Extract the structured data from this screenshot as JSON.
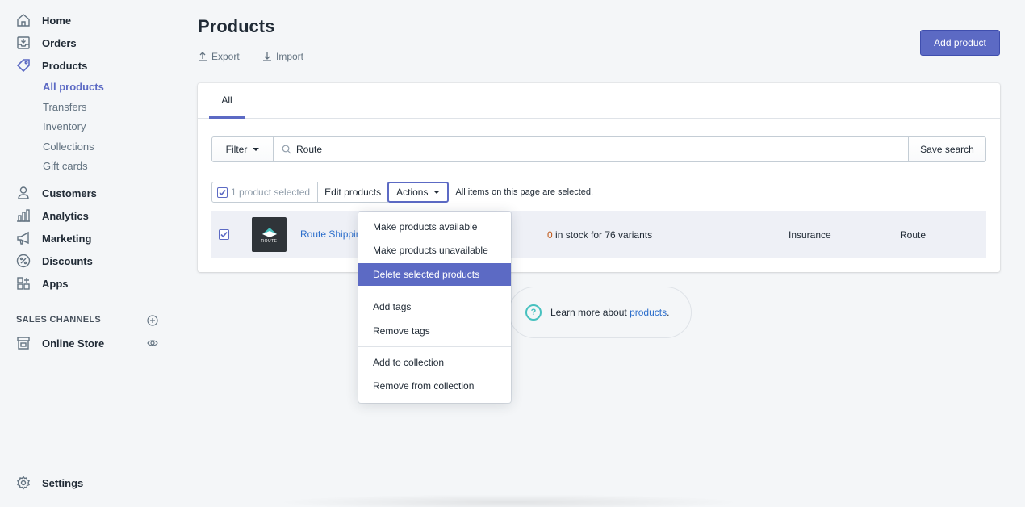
{
  "sidebar": {
    "items": [
      {
        "label": "Home",
        "icon": "home-icon"
      },
      {
        "label": "Orders",
        "icon": "orders-icon"
      },
      {
        "label": "Products",
        "icon": "tag-icon"
      },
      {
        "label": "Customers",
        "icon": "person-icon"
      },
      {
        "label": "Analytics",
        "icon": "bar-chart-icon"
      },
      {
        "label": "Marketing",
        "icon": "megaphone-icon"
      },
      {
        "label": "Discounts",
        "icon": "discount-icon"
      },
      {
        "label": "Apps",
        "icon": "apps-icon"
      }
    ],
    "product_sub": [
      "All products",
      "Transfers",
      "Inventory",
      "Collections",
      "Gift cards"
    ],
    "sales_channels_label": "SALES CHANNELS",
    "online_store": "Online Store",
    "settings": "Settings"
  },
  "header": {
    "title": "Products",
    "export_label": "Export",
    "import_label": "Import",
    "add_product_label": "Add product"
  },
  "tabs": {
    "all": "All"
  },
  "filter": {
    "filter_label": "Filter",
    "search_value": "Route",
    "save_search_label": "Save search"
  },
  "bulk": {
    "selected_label": "1 product selected",
    "edit_label": "Edit products",
    "actions_label": "Actions",
    "note": "All items on this page are selected."
  },
  "product": {
    "thumb_text": "ROUTE",
    "name": "Route Shipping Insurance",
    "stock_zero": "0",
    "stock_rest": " in stock for 76 variants",
    "type": "Insurance",
    "vendor": "Route"
  },
  "actions_menu": {
    "items": [
      "Make products available",
      "Make products unavailable",
      "Delete selected products",
      "Add tags",
      "Remove tags",
      "Add to collection",
      "Remove from collection"
    ],
    "highlighted": "Delete selected products"
  },
  "help": {
    "prefix": "Learn more about ",
    "link": "products",
    "suffix": "."
  },
  "colors": {
    "accent": "#5c6ac4",
    "link": "#2c6ecb",
    "warning": "#c05717",
    "help": "#47c1bf"
  }
}
